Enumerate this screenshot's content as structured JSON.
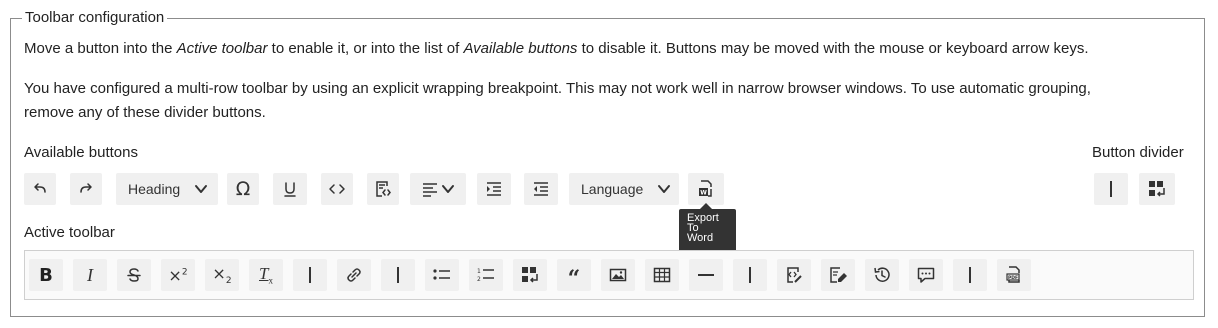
{
  "fieldset": {
    "legend": "Toolbar configuration"
  },
  "description": {
    "part1": "Move a button into the ",
    "active_em": "Active toolbar",
    "part2": " to enable it, or into the list of ",
    "available_em": "Available buttons",
    "part3": " to disable it. Buttons may be moved with the mouse or keyboard arrow keys."
  },
  "warning": {
    "line1": "You have configured a multi-row toolbar by using an explicit wrapping breakpoint. This may not work well in narrow browser windows. To use automatic grouping,",
    "line2": "remove any of these divider buttons."
  },
  "available": {
    "label": "Available buttons",
    "heading_label": "Heading",
    "language_label": "Language",
    "icons": [
      "undo-icon",
      "redo-icon",
      "heading-dropdown",
      "special-characters-icon",
      "underline-icon",
      "code-icon",
      "source-editing-icon",
      "alignment-dropdown",
      "indent-icon",
      "outdent-icon",
      "language-dropdown",
      "export-to-word-icon"
    ]
  },
  "divider": {
    "label": "Button divider",
    "icons": [
      "divider-bar-icon",
      "wrapping-breakpoint-icon"
    ]
  },
  "tooltip": {
    "text_line1": "Export",
    "text_line2": "To",
    "text_line3": "Word"
  },
  "active": {
    "label": "Active toolbar",
    "icons": [
      "bold-icon",
      "italic-icon",
      "strikethrough-icon",
      "superscript-icon",
      "subscript-icon",
      "remove-format-icon",
      "divider-bar-icon",
      "link-icon",
      "divider-bar-icon",
      "bulleted-list-icon",
      "numbered-list-icon",
      "wrapping-breakpoint-icon",
      "blockquote-icon",
      "image-icon",
      "table-icon",
      "horizontal-line-icon",
      "divider-bar-icon",
      "source-editing-icon",
      "edit-icon",
      "revision-history-icon",
      "comments-icon",
      "divider-bar-icon",
      "export-to-pdf-icon"
    ]
  }
}
